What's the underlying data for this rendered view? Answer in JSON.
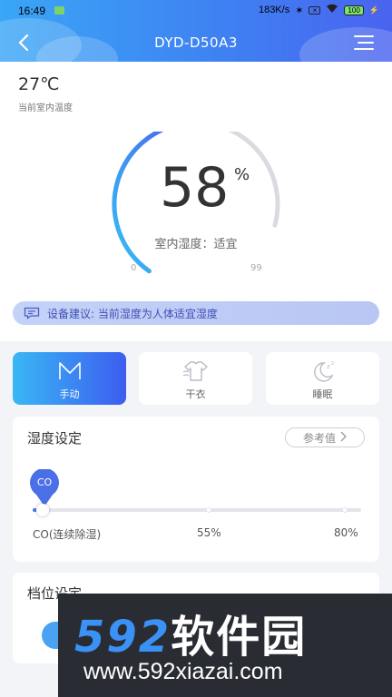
{
  "status_bar": {
    "time": "16:49",
    "speed": "183K/s",
    "battery": "100"
  },
  "header": {
    "title": "DYD-D50A3"
  },
  "room": {
    "temperature": "27℃",
    "temperature_label": "当前室内温度"
  },
  "gauge": {
    "value": "58",
    "unit": "%",
    "value_fraction": 0.58,
    "status_label": "室内湿度：",
    "status_value": "适宜",
    "min": "0",
    "max": "99"
  },
  "advice": {
    "text": "设备建议: 当前湿度为人体适宜湿度"
  },
  "modes": [
    {
      "label": "手动",
      "icon": "manual-m-icon",
      "active": true
    },
    {
      "label": "干衣",
      "icon": "shirt-dry-icon",
      "active": false
    },
    {
      "label": "睡眠",
      "icon": "moon-sleep-icon",
      "active": false
    }
  ],
  "humidity_setting": {
    "title": "湿度设定",
    "reference_button": "参考值",
    "pin_label": "CO",
    "slider_labels": [
      "CO(连续除湿)",
      "55%",
      "80%"
    ]
  },
  "gear_setting": {
    "title": "档位设定"
  },
  "watermark": {
    "brand_digits": "592",
    "brand_text": "软件园",
    "url": "www.592xiazai.com"
  },
  "colors": {
    "accent": "#3f7ff2",
    "gauge_start": "#35c0f5",
    "gauge_end": "#4a5cee",
    "watermark_bg": "#2a2c33"
  }
}
